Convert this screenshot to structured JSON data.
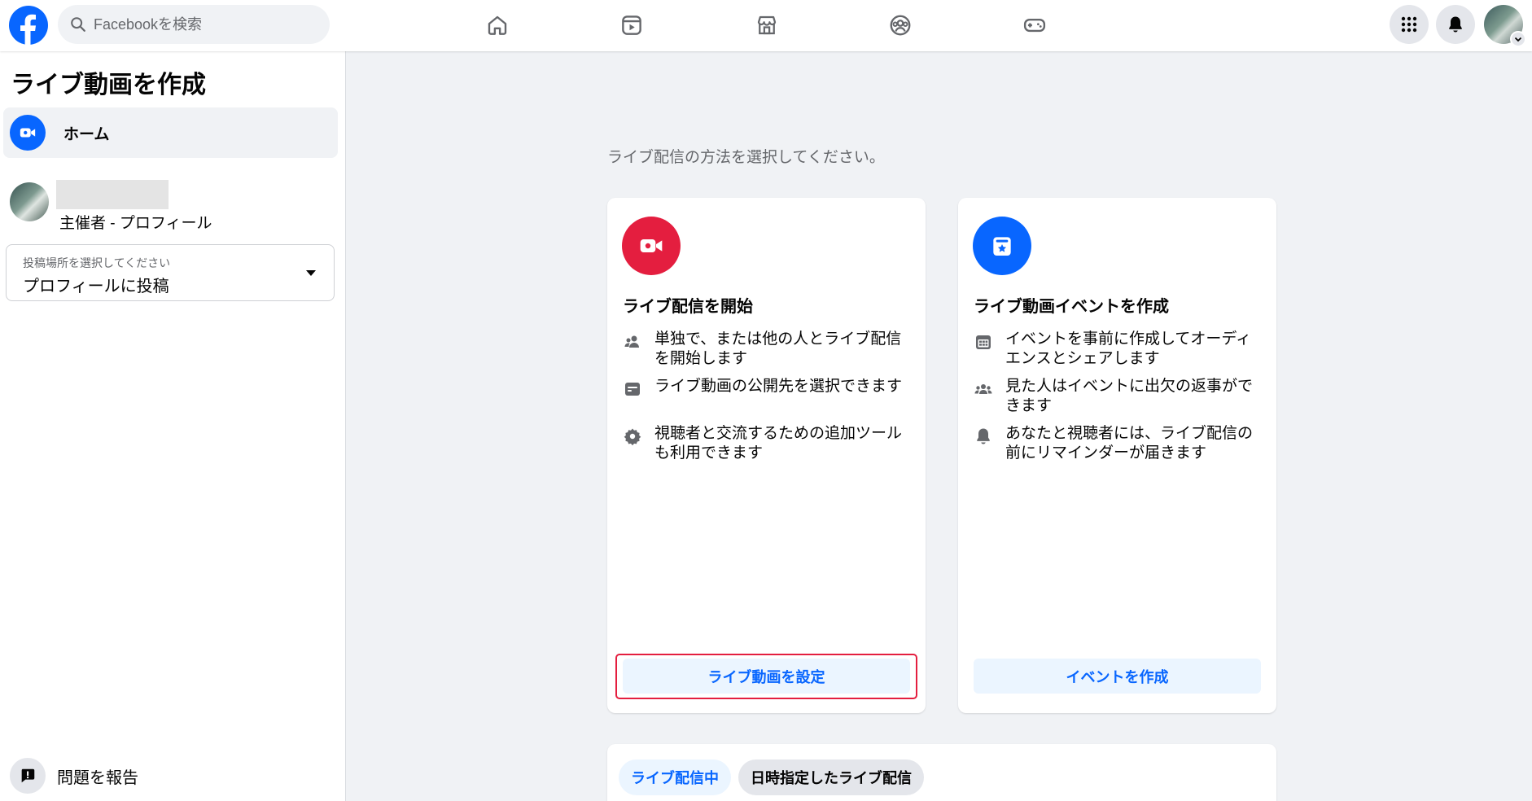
{
  "colors": {
    "brand_blue": "#0866ff",
    "live_red": "#e41e3f",
    "page_bg": "#f0f2f5",
    "highlight_red": "#e41e3f"
  },
  "topbar": {
    "logo": "facebook-logo",
    "search_placeholder": "Facebookを検索",
    "nav_icons": [
      "home-icon",
      "video-icon",
      "marketplace-icon",
      "groups-icon",
      "gaming-icon"
    ],
    "right_icons": [
      "menu-grid-icon",
      "notifications-bell-icon",
      "account-avatar"
    ]
  },
  "sidebar": {
    "title": "ライブ動画を作成",
    "home_label": "ホーム",
    "host_role": "主催者 - プロフィール",
    "post_location_hint": "投稿場所を選択してください",
    "post_location_value": "プロフィールに投稿",
    "report_label": "問題を報告"
  },
  "main": {
    "prompt": "ライブ配信の方法を選択してください。",
    "live_card": {
      "title": "ライブ配信を開始",
      "features": [
        {
          "icon": "people-icon",
          "text": "単独で、または他の人とライブ配信を開始します"
        },
        {
          "icon": "audience-icon",
          "text": "ライブ動画の公開先を選択できます"
        },
        {
          "icon": "gear-icon",
          "text": "視聴者と交流するための追加ツールも利用できます"
        }
      ],
      "button": "ライブ動画を設定"
    },
    "event_card": {
      "title": "ライブ動画イベントを作成",
      "features": [
        {
          "icon": "calendar-icon",
          "text": "イベントを事前に作成してオーディエンスとシェアします"
        },
        {
          "icon": "group-icon",
          "text": "見た人はイベントに出欠の返事ができます"
        },
        {
          "icon": "bell-icon",
          "text": "あなたと視聴者には、ライブ配信の前にリマインダーが届きます"
        }
      ],
      "button": "イベントを作成"
    },
    "tabs": {
      "active": "ライブ配信中",
      "inactive": "日時指定したライブ配信"
    }
  }
}
